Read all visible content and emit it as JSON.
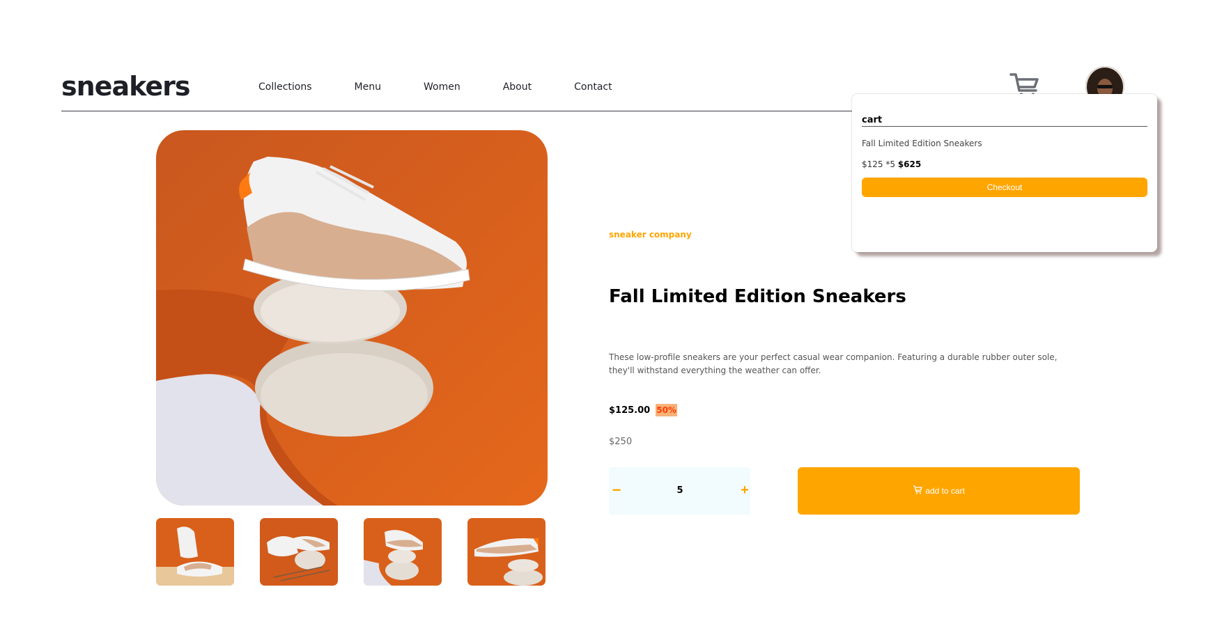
{
  "header": {
    "logo": "sneakers",
    "nav": [
      "Collections",
      "Menu",
      "Women",
      "About",
      "Contact"
    ]
  },
  "cart_popup": {
    "title": "cart",
    "item_name": "Fall Limited Edition Sneakers",
    "item_calc": "$125 *5",
    "item_total": "$625",
    "checkout_label": "Checkout"
  },
  "product": {
    "company": "sneaker company",
    "title": "Fall Limited Edition Sneakers",
    "description": "These low-profile sneakers are your perfect casual wear companion. Featuring a durable rubber outer sole, they'll withstand everything the weather can offer.",
    "price": "$125.00",
    "discount": "50%",
    "old_price": "$250"
  },
  "quantity": {
    "minus": "−",
    "value": "5",
    "plus": "+"
  },
  "add_to_cart_label": "add to cart",
  "colors": {
    "accent": "#ffa500",
    "background_orange": "#d9601a",
    "text_dark": "#1d2026"
  },
  "icons": [
    "cart-icon",
    "avatar",
    "minus-icon",
    "plus-icon",
    "cart-small-icon"
  ]
}
